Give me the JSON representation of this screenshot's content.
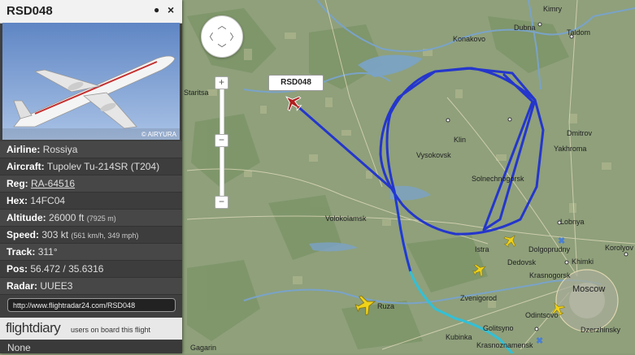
{
  "panel": {
    "callsign": "RSD048",
    "pin_icon": "●",
    "close_icon": "×",
    "photo_credit": "© AIRYURA",
    "rows": {
      "airline": {
        "label": "Airline:",
        "value": "Rossiya"
      },
      "aircraft": {
        "label": "Aircraft:",
        "value": "Tupolev Tu-214SR (T204)"
      },
      "reg": {
        "label": "Reg:",
        "value": "RA-64516"
      },
      "hex": {
        "label": "Hex:",
        "value": "14FC04"
      },
      "altitude": {
        "label": "Altitude:",
        "value": "26000 ft",
        "extra": "(7925 m)"
      },
      "speed": {
        "label": "Speed:",
        "value": "303 kt",
        "extra": "(561 km/h, 349 mph)"
      },
      "track": {
        "label": "Track:",
        "value": "311°"
      },
      "pos": {
        "label": "Pos:",
        "value": "56.472 / 35.6316"
      },
      "radar": {
        "label": "Radar:",
        "value": "UUEE3"
      }
    },
    "url": "http://www.flightradar24.com/RSD048",
    "flightdiary": {
      "logo": "flightdiary",
      "text": "users on board this flight"
    },
    "passengers": "None"
  },
  "map": {
    "callsign_tag": "RSD048",
    "places": {
      "kimry": "Kimry",
      "dubna": "Dubna",
      "taldom": "Taldom",
      "konakovo": "Konakovo",
      "staritsa": "Staritsa",
      "klin": "Klin",
      "vysokovsk": "Vysokovsk",
      "solnechnogorsk": "Solnechnogorsk",
      "dmitrov": "Dmitrov",
      "yakhroma": "Yakhroma",
      "lobnya": "Lobnya",
      "volokolamsk": "Volokolamsk",
      "istra": "Istra",
      "dolgoprudny": "Dolgoprudny",
      "dedovsk": "Dedovsk",
      "khimki": "Khimki",
      "korolyov": "Korolyov",
      "krasnogorsk": "Krasnogorsk",
      "moscow": "Moscow",
      "zvenigorod": "Zvenigorod",
      "odintsovo": "Odintsovo",
      "ruza": "Ruza",
      "golitsyno": "Golitsyno",
      "kubinka": "Kubinka",
      "krasnoznamensk": "Krasnoznamensk",
      "dzerzhinsky": "Dzerzhinsky",
      "gagarin": "Gagarin"
    },
    "zoom_in": "+",
    "zoom_out": "−",
    "colors": {
      "track_blue": "#2233cc",
      "track_cyan": "#33c0d0",
      "selected_plane": "#b02020",
      "other_planes": "#f2d21a"
    }
  }
}
